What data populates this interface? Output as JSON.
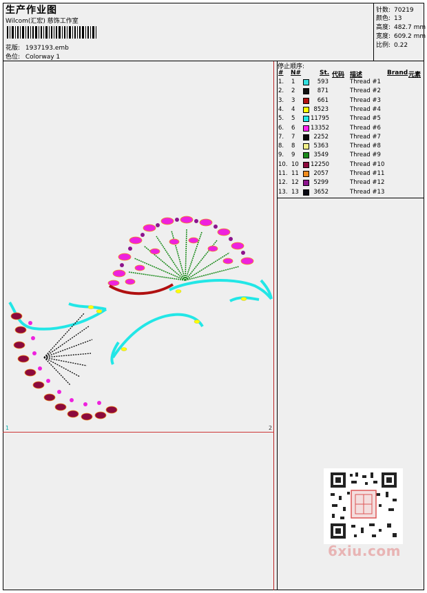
{
  "header": {
    "title": "生产作业图",
    "subtitle": "Wilcom(汇宏) 慈饰工作室",
    "design_label": "花版:",
    "design_value": "1937193.emb",
    "colorway_label": "色位:",
    "colorway_value": "Colorway 1"
  },
  "stats": {
    "stitches_label": "针数:",
    "stitches_value": "70219",
    "colors_label": "颜色:",
    "colors_value": "13",
    "height_label": "高度:",
    "height_value": "482.7 mm",
    "width_label": "宽度:",
    "width_value": "609.2 mm",
    "scale_label": "比例:",
    "scale_value": "0.22"
  },
  "threads": {
    "title": "停止顺序:",
    "col_num": "#",
    "col_n": "N#",
    "col_st": "St.",
    "col_code": "代码",
    "col_desc": "描述",
    "col_brand": "Brand",
    "col_elem": "元素",
    "rows": [
      {
        "idx": "1.",
        "n": "1",
        "st": "593",
        "color": "#33e0e0",
        "desc": "Thread #1"
      },
      {
        "idx": "2.",
        "n": "2",
        "st": "871",
        "color": "#111111",
        "desc": "Thread #2"
      },
      {
        "idx": "3.",
        "n": "3",
        "st": "661",
        "color": "#b01010",
        "desc": "Thread #3"
      },
      {
        "idx": "4.",
        "n": "4",
        "st": "8523",
        "color": "#ffff00",
        "desc": "Thread #4"
      },
      {
        "idx": "5.",
        "n": "5",
        "st": "11795",
        "color": "#22e6e6",
        "desc": "Thread #5"
      },
      {
        "idx": "6.",
        "n": "6",
        "st": "13352",
        "color": "#ff22ee",
        "desc": "Thread #6"
      },
      {
        "idx": "7.",
        "n": "7",
        "st": "2252",
        "color": "#0a0a0a",
        "desc": "Thread #7"
      },
      {
        "idx": "8.",
        "n": "8",
        "st": "5363",
        "color": "#f2f08a",
        "desc": "Thread #8"
      },
      {
        "idx": "9.",
        "n": "9",
        "st": "3549",
        "color": "#1a8a1a",
        "desc": "Thread #9"
      },
      {
        "idx": "10.",
        "n": "10",
        "st": "12250",
        "color": "#8c0a3c",
        "desc": "Thread #10"
      },
      {
        "idx": "11.",
        "n": "11",
        "st": "2057",
        "color": "#f08c1e",
        "desc": "Thread #11"
      },
      {
        "idx": "12.",
        "n": "12",
        "st": "5299",
        "color": "#8c148c",
        "desc": "Thread #12"
      },
      {
        "idx": "13.",
        "n": "13",
        "st": "3652",
        "color": "#0a0a14",
        "desc": "Thread #13"
      }
    ]
  },
  "canvas": {
    "corner_left": "1",
    "corner_right": "2"
  },
  "watermark": {
    "site": "6xiu.com",
    "seal_icon": "qr-code-icon"
  }
}
